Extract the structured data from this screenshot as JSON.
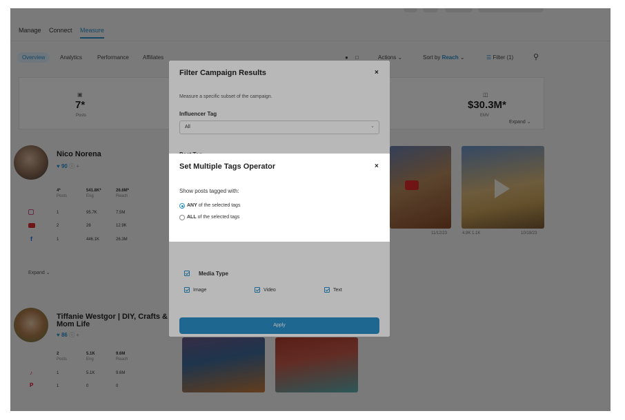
{
  "nav": {
    "manage": "Manage",
    "connect": "Connect",
    "measure": "Measure"
  },
  "subnav": {
    "overview": "Overview",
    "analytics": "Analytics",
    "performance": "Performance",
    "affiliates": "Affiliates",
    "actions": "Actions",
    "sort_prefix": "Sort by",
    "sort_value": "Reach",
    "filter": "Filter (1)"
  },
  "summary": {
    "posts_value": "7*",
    "posts_label": "Posts",
    "emv_value": "$30.3M*",
    "emv_label": "EMV",
    "expand": "Expand"
  },
  "influencers": [
    {
      "name": "Nico Norena",
      "score": "90",
      "posts": "4*",
      "posts_label": "Posts",
      "eng": "541.8K*",
      "eng_label": "Eng",
      "reach": "26.6M*",
      "reach_label": "Reach",
      "rows": [
        {
          "count": "1",
          "eng": "95.7K",
          "reach": "7.5M"
        },
        {
          "count": "2",
          "eng": "28",
          "reach": "12.9K"
        },
        {
          "count": "1",
          "eng": "446.1K",
          "reach": "26.3M"
        }
      ],
      "expand": "Expand"
    },
    {
      "name": "Tiffanie Westgor | DIY, Crafts &",
      "name2": "Mom Life",
      "score": "86",
      "posts": "2",
      "posts_label": "Posts",
      "eng": "5.1K",
      "eng_label": "Eng",
      "reach": "9.6M",
      "reach_label": "Reach",
      "rows": [
        {
          "count": "1",
          "eng": "5.1K",
          "reach": "9.6M"
        },
        {
          "count": "1",
          "eng": "0",
          "reach": "0"
        }
      ]
    }
  ],
  "thumb_captions": {
    "t1": "11/12/23",
    "t2": "4.9K 1.1K",
    "t3": "10/19/23"
  },
  "filter_modal": {
    "title": "Filter Campaign Results",
    "subtitle": "Measure a specific subset of the campaign.",
    "influencer_tag_label": "Influencer Tag",
    "influencer_tag_value": "All",
    "post_tag_label": "Post Tag",
    "media_type_label": "Media Type",
    "media_options": [
      "Image",
      "Video",
      "Text"
    ],
    "apply_label": "Apply"
  },
  "tags_dialog": {
    "title": "Set Multiple Tags Operator",
    "prompt": "Show posts tagged with:",
    "any_bold": "ANY",
    "any_rest": "of the selected tags",
    "all_bold": "ALL",
    "all_rest": "of the selected tags",
    "selected": "any"
  },
  "colors": {
    "accent": "#2a8fc9",
    "apply_button": "#2a8fc9",
    "youtube": "#e02b2b",
    "tiktok": "#e0245e"
  }
}
